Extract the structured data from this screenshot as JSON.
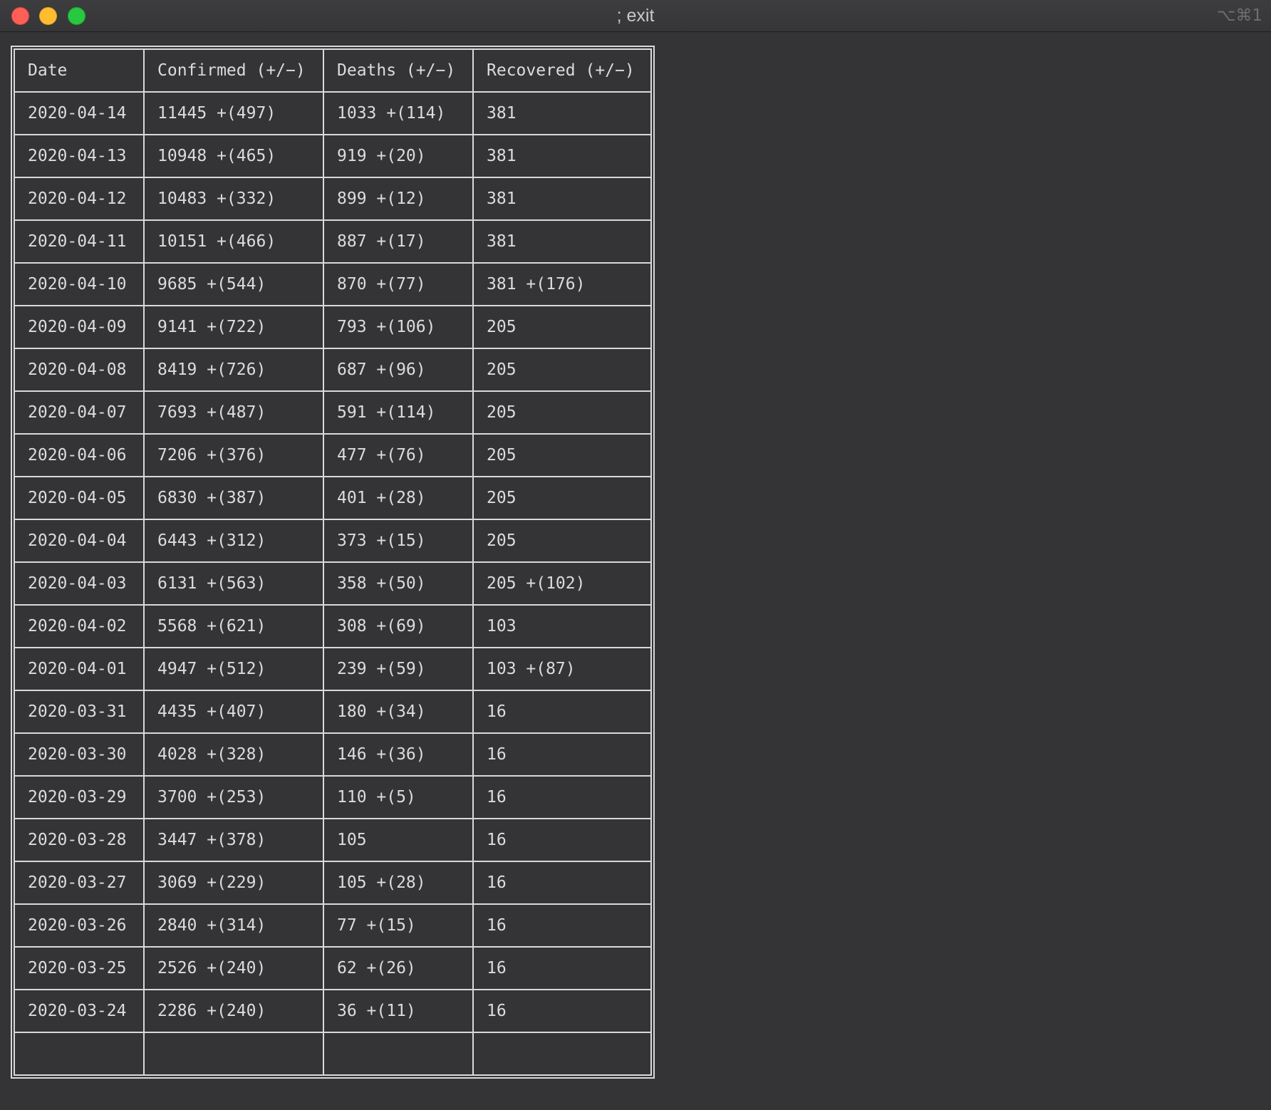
{
  "window": {
    "title": "; exit",
    "shortcut": "⌥⌘1"
  },
  "table": {
    "headers": [
      "Date",
      "Confirmed (+/−)",
      "Deaths (+/−)",
      "Recovered (+/−)"
    ],
    "rows": [
      [
        "2020-04-14",
        "11445 +(497)",
        "1033 +(114)",
        "381"
      ],
      [
        "2020-04-13",
        "10948 +(465)",
        "919 +(20)",
        "381"
      ],
      [
        "2020-04-12",
        "10483 +(332)",
        "899 +(12)",
        "381"
      ],
      [
        "2020-04-11",
        "10151 +(466)",
        "887 +(17)",
        "381"
      ],
      [
        "2020-04-10",
        "9685 +(544)",
        "870 +(77)",
        "381 +(176)"
      ],
      [
        "2020-04-09",
        "9141 +(722)",
        "793 +(106)",
        "205"
      ],
      [
        "2020-04-08",
        "8419 +(726)",
        "687 +(96)",
        "205"
      ],
      [
        "2020-04-07",
        "7693 +(487)",
        "591 +(114)",
        "205"
      ],
      [
        "2020-04-06",
        "7206 +(376)",
        "477 +(76)",
        "205"
      ],
      [
        "2020-04-05",
        "6830 +(387)",
        "401 +(28)",
        "205"
      ],
      [
        "2020-04-04",
        "6443 +(312)",
        "373 +(15)",
        "205"
      ],
      [
        "2020-04-03",
        "6131 +(563)",
        "358 +(50)",
        "205 +(102)"
      ],
      [
        "2020-04-02",
        "5568 +(621)",
        "308 +(69)",
        "103"
      ],
      [
        "2020-04-01",
        "4947 +(512)",
        "239 +(59)",
        "103 +(87)"
      ],
      [
        "2020-03-31",
        "4435 +(407)",
        "180 +(34)",
        "16"
      ],
      [
        "2020-03-30",
        "4028 +(328)",
        "146 +(36)",
        "16"
      ],
      [
        "2020-03-29",
        "3700 +(253)",
        "110 +(5)",
        "16"
      ],
      [
        "2020-03-28",
        "3447 +(378)",
        "105",
        "16"
      ],
      [
        "2020-03-27",
        "3069 +(229)",
        "105 +(28)",
        "16"
      ],
      [
        "2020-03-26",
        "2840 +(314)",
        "77 +(15)",
        "16"
      ],
      [
        "2020-03-25",
        "2526 +(240)",
        "62 +(26)",
        "16"
      ],
      [
        "2020-03-24",
        "2286 +(240)",
        "36 +(11)",
        "16"
      ],
      [
        "",
        "",
        "",
        ""
      ]
    ]
  }
}
